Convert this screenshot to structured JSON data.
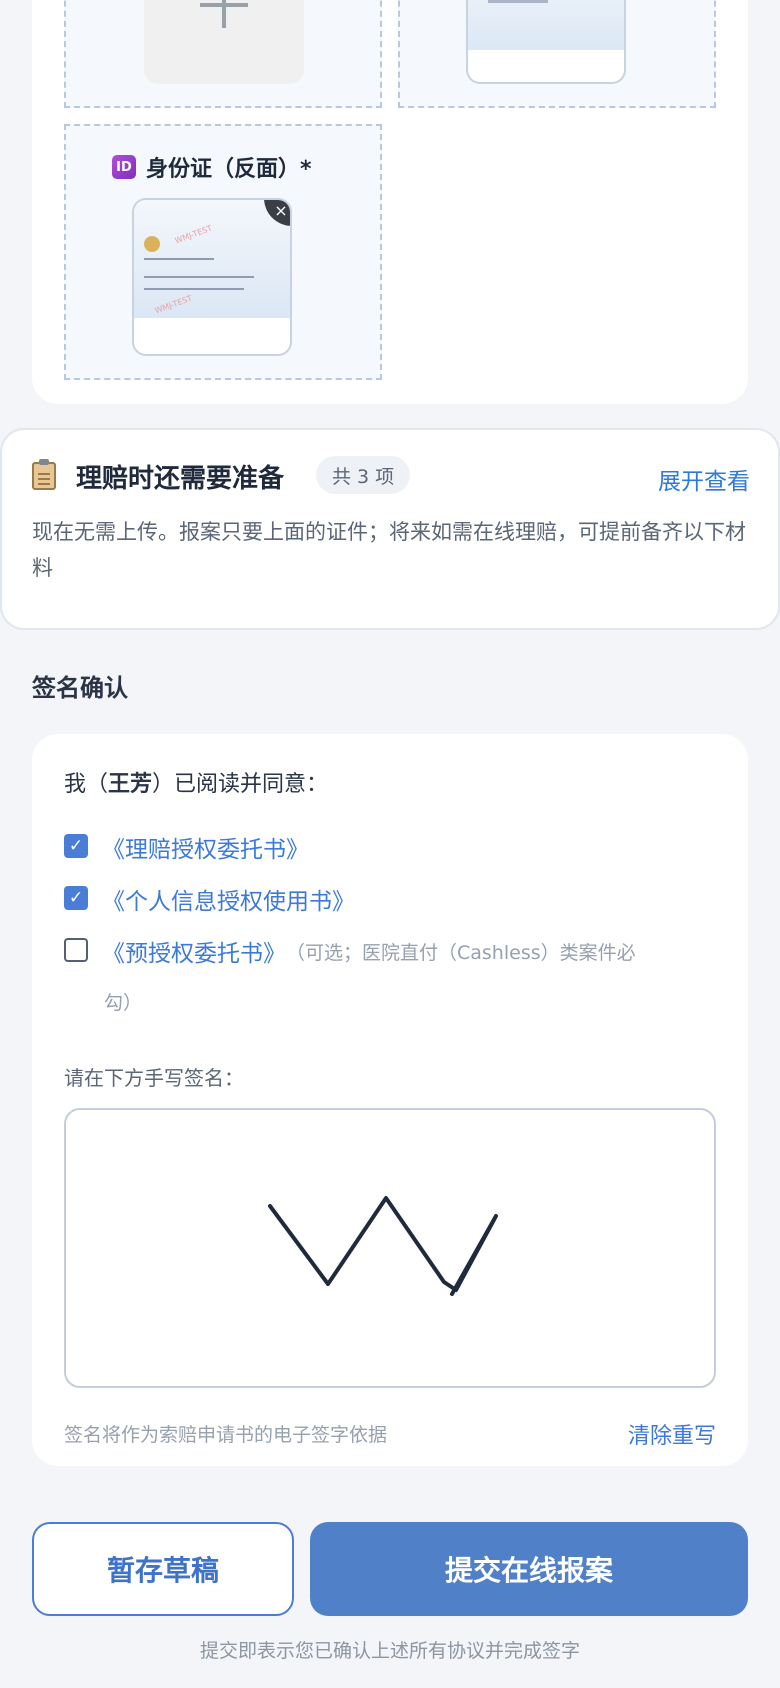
{
  "upload": {
    "back_title": "身份证（反面）*",
    "id_icon_text": "ID",
    "remove_symbol": "×"
  },
  "prepare": {
    "title": "理赔时还需要准备",
    "count": "共 3 项",
    "expand": "展开查看",
    "desc": "现在无需上传。报案只要上面的证件；将来如需在线理赔，可提前备齐以下材料"
  },
  "sign": {
    "section_title": "签名确认",
    "agree_prefix": "我（",
    "agree_name": "王芳",
    "agree_suffix": "）已阅读并同意：",
    "docs": [
      {
        "label": "《理赔授权委托书》",
        "checked": true
      },
      {
        "label": "《个人信息授权使用书》",
        "checked": true
      },
      {
        "label": "《预授权委托书》",
        "checked": false,
        "note": "（可选；医院直付（Cashless）类案件必",
        "note_cont": "勾）"
      }
    ],
    "check_mark": "✓",
    "pad_label": "请在下方手写签名：",
    "hint": "签名将作为索赔申请书的电子签字依据",
    "clear": "清除重写"
  },
  "actions": {
    "draft": "暂存草稿",
    "submit": "提交在线报案",
    "note": "提交即表示您已确认上述所有协议并完成签字"
  }
}
